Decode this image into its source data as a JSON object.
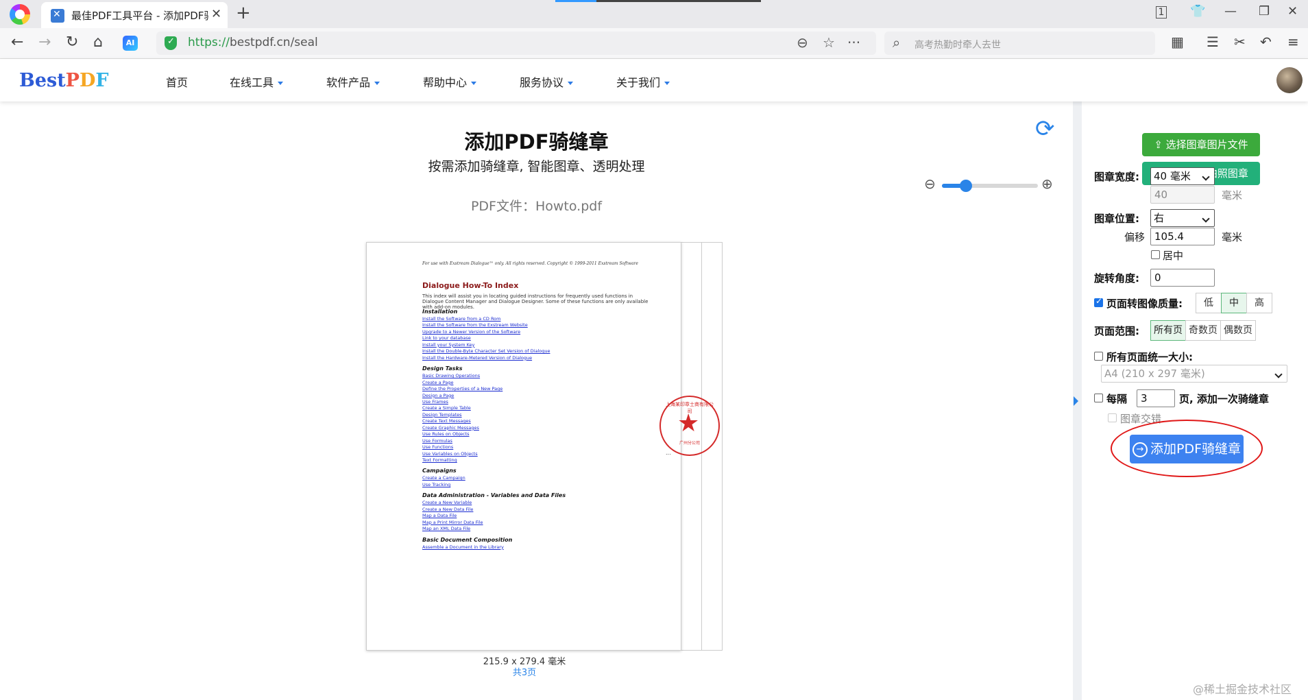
{
  "browser": {
    "tab_title": "最佳PDF工具平台 - 添加PDF骑缝章",
    "url_scheme": "https://",
    "url_rest": "bestpdf.cn/seal",
    "search_placeholder": "高考热勤时牵人去世",
    "tab_count": "1"
  },
  "site": {
    "logo": {
      "best": "Best",
      "p": "P",
      "d": "D",
      "f": "F"
    },
    "menu": [
      "首页",
      "在线工具",
      "软件产品",
      "帮助中心",
      "服务协议",
      "关于我们"
    ]
  },
  "main": {
    "title": "添加PDF骑缝章",
    "subtitle": "按需添加骑缝章, 智能图章、透明处理",
    "file_label": "PDF文件：Howto.pdf",
    "zoom_level": 0.25,
    "page_size": "215.9 x 279.4 毫米",
    "page_count": "共3页"
  },
  "document": {
    "header": "For use with Exstream Dialogue™ only. All rights reserved. Copyright © 1999-2011 Exstream Software",
    "title": "Dialogue How-To Index",
    "intro": "This index will assist you in locating guided instructions for frequently used functions in Dialogue Content Manager and Dialogue Designer. Some of these functions are only available with add-on modules.",
    "sections": [
      {
        "name": "Installation",
        "links": [
          "Install the Software from a CD Rom",
          "Install the Software from the Exstream Website",
          "Upgrade to a Newer Version of the Software",
          "Link to your database",
          "Install your System Key",
          "Install the Double-Byte Character Set Version of Dialogue",
          "Install the Hardware-Metered Version of Dialogue"
        ]
      },
      {
        "name": "Design Tasks",
        "links": [
          "Basic Drawing Operations",
          "Create a Page",
          "Define the Properties of a New Page",
          "Design a Page",
          "Use Frames",
          "Create a Simple Table",
          "Design Templates",
          "Create Text Messages",
          "Create Graphic Messages",
          "Use Rules on Objects",
          "Use Formulas",
          "Use Functions",
          "Use Variables on Objects",
          "Text Formatting"
        ]
      },
      {
        "name": "Campaigns",
        "links": [
          "Create a Campaign",
          "Use Tracking"
        ]
      },
      {
        "name": "Data Administration - Variables and Data Files",
        "links": [
          "Create a New Variable",
          "Create a New Data File",
          "Map a Data File",
          "Map a Print Mirror Data File",
          "Map an XML Data File"
        ]
      },
      {
        "name": "Basic Document Composition",
        "links": [
          "Assemble a Document in the Library"
        ]
      }
    ],
    "page_dots": "...",
    "seal_text": "上海某印章士商有限公司",
    "seal_code": "广州分公司"
  },
  "panel": {
    "btn_select_image": "选择图章图片文件",
    "btn_camera": "用摄像头拍照图章",
    "width_label": "图章宽度:",
    "width_select": "40 毫米",
    "width_value": "40",
    "unit_mm": "毫米",
    "position_label": "图章位置:",
    "position_select": "右",
    "offset_label": "偏移",
    "offset_value": "105.4",
    "center_label": "居中",
    "center_checked": false,
    "rotate_label": "旋转角度:",
    "rotate_value": "0",
    "quality_label": "页面转图像质量:",
    "quality_checked": true,
    "quality_options": [
      "低",
      "中",
      "高"
    ],
    "quality_selected": "中",
    "range_label": "页面范围:",
    "range_options": [
      "所有页",
      "奇数页",
      "偶数页"
    ],
    "range_selected": "所有页",
    "uniform_label": "所有页面统一大小:",
    "uniform_checked": false,
    "paper_select": "A4 (210 x 297 毫米)",
    "every_label": "每隔",
    "every_value": "3",
    "every_suffix": "页, 添加一次骑缝章",
    "every_checked": false,
    "interleave_label": "图章交错",
    "submit_label": "添加PDF骑缝章"
  },
  "watermark": "@稀土掘金技术社区",
  "colors": {
    "accent": "#2a84e8",
    "green": "#3caa3c",
    "seal_red": "#d42a2a",
    "annotation_red": "#e01818"
  }
}
